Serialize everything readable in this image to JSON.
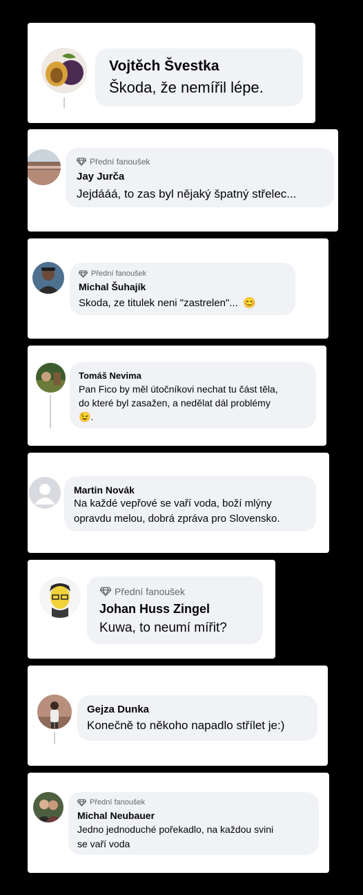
{
  "comments": [
    {
      "badge": "",
      "name": "Vojtěch Švestka",
      "lines": [
        "Škoda, že nemířil lépe."
      ],
      "avatar_icon": "plum-icon"
    },
    {
      "badge": "Přední fanoušek",
      "name": "Jay Jurča",
      "lines": [
        "Jejdááá, to zas byl nějaký špatný střelec..."
      ],
      "avatar_icon": "landscape-photo-icon"
    },
    {
      "badge": "Přední fanoušek",
      "name": "Michal Šuhajík",
      "lines": [
        "Skoda, ze titulek neni \"zastrelen\"..."
      ],
      "emoji": "😊",
      "avatar_icon": "person-photo-icon"
    },
    {
      "badge": "",
      "name": "Tomáš Nevima",
      "lines": [
        "Pan Fico by měl útočníkovi nechat tu část těla,",
        "do které byl zasažen, a nedělat dál problémy"
      ],
      "emoji_line": ".",
      "emoji": "😉",
      "avatar_icon": "outdoor-photo-icon"
    },
    {
      "badge": "",
      "name": "Martin Novák",
      "lines": [
        "Na každé vepřové se vaří voda, boží mlýny",
        "opravdu melou, dobrá zpráva pro Slovensko."
      ],
      "avatar_icon": "default-user-icon"
    },
    {
      "badge": "Přední fanoušek",
      "name": "Johan Huss Zingel",
      "lines": [
        "Kuwa, to neumí mířit?"
      ],
      "avatar_icon": "cartoon-face-icon"
    },
    {
      "badge": "",
      "name": "Gejza Dunka",
      "lines": [
        "Konečně to někoho napadlo střílet je:)"
      ],
      "avatar_icon": "person-standing-icon"
    },
    {
      "badge": "Přední fanoušek",
      "name": "Michal Neubauer",
      "lines": [
        "Jedno jednoduché pořekadlo, na každou svini",
        "se vaří voda"
      ],
      "avatar_icon": "couple-photo-icon"
    }
  ],
  "colors": {
    "background": "#000000",
    "card": "#ffffff",
    "bubble": "#f0f2f5",
    "secondary_text": "#65676b"
  }
}
